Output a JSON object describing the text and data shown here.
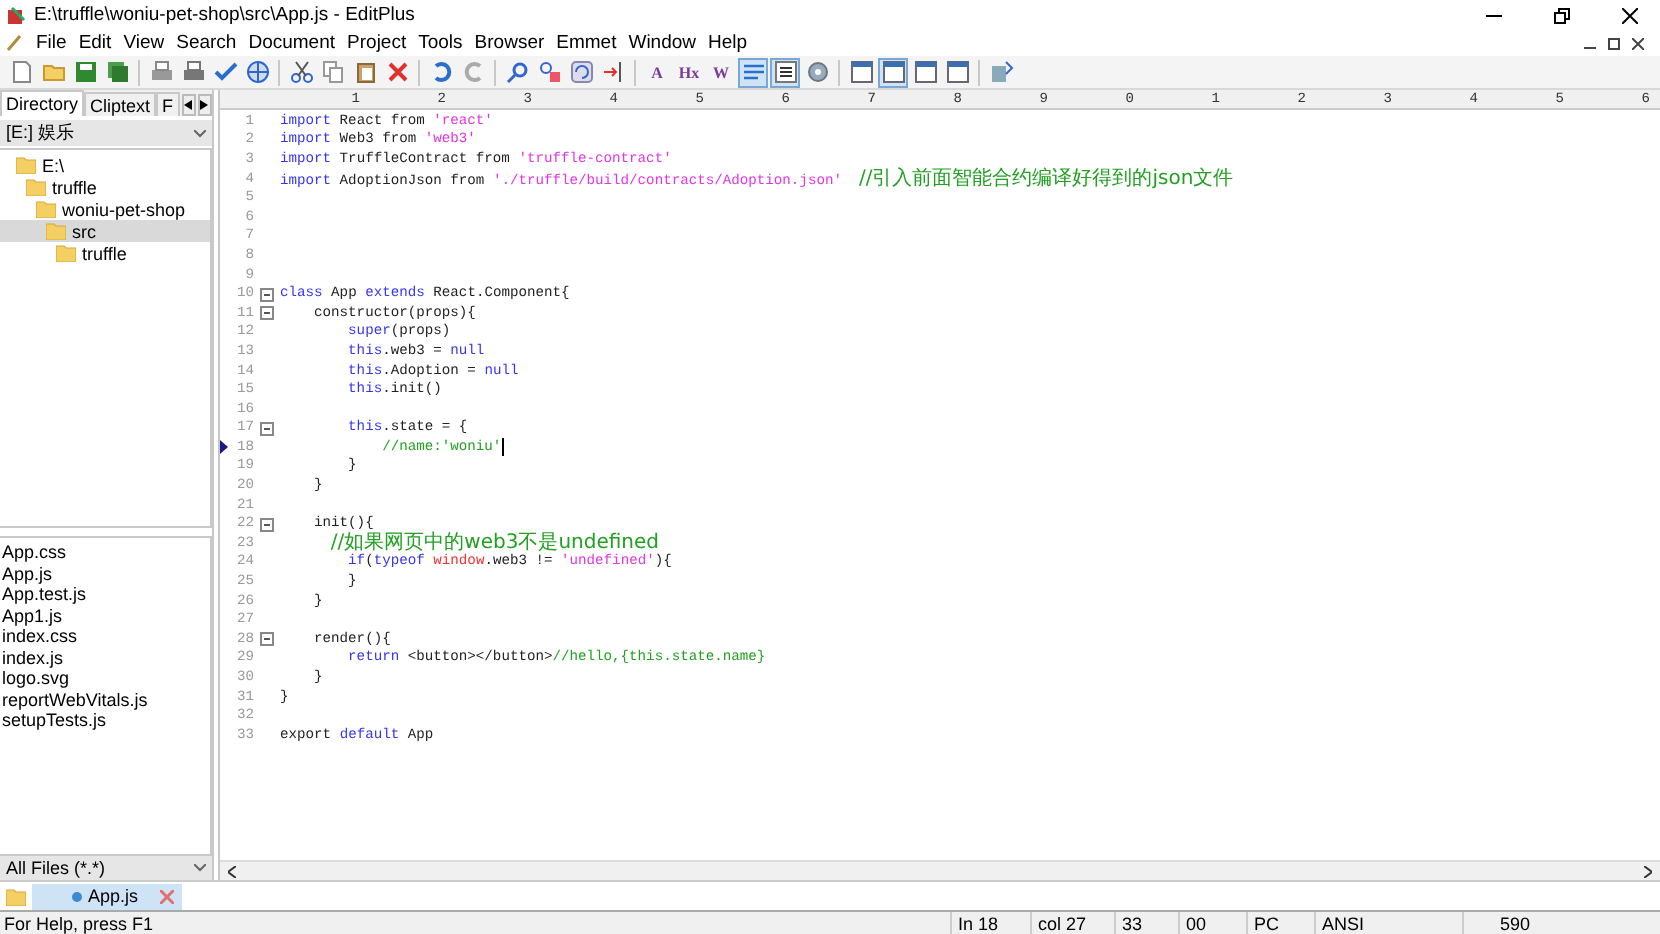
{
  "window": {
    "title": "E:\\truffle\\woniu-pet-shop\\src\\App.js - EditPlus"
  },
  "menu": [
    "File",
    "Edit",
    "View",
    "Search",
    "Document",
    "Project",
    "Tools",
    "Browser",
    "Emmet",
    "Window",
    "Help"
  ],
  "toolbar": [
    {
      "kind": "new",
      "pressed": false
    },
    {
      "kind": "open",
      "pressed": false
    },
    {
      "kind": "save",
      "pressed": false
    },
    {
      "kind": "saveall",
      "pressed": false
    },
    {
      "kind": "sep"
    },
    {
      "kind": "preview",
      "pressed": false
    },
    {
      "kind": "print",
      "pressed": false
    },
    {
      "kind": "spell",
      "pressed": false
    },
    {
      "kind": "browser",
      "pressed": false
    },
    {
      "kind": "sep"
    },
    {
      "kind": "cut",
      "pressed": false
    },
    {
      "kind": "copy",
      "pressed": false
    },
    {
      "kind": "paste",
      "pressed": false
    },
    {
      "kind": "delete",
      "pressed": false
    },
    {
      "kind": "sep"
    },
    {
      "kind": "undo",
      "pressed": false
    },
    {
      "kind": "redo",
      "pressed": false
    },
    {
      "kind": "sep"
    },
    {
      "kind": "find",
      "pressed": false
    },
    {
      "kind": "replace",
      "pressed": false
    },
    {
      "kind": "refresh",
      "pressed": false
    },
    {
      "kind": "goto",
      "pressed": false
    },
    {
      "kind": "sep"
    },
    {
      "kind": "glyph",
      "label": "A",
      "pressed": false
    },
    {
      "kind": "glyph",
      "label": "Hx",
      "pressed": false
    },
    {
      "kind": "glyph",
      "label": "W",
      "pressed": false
    },
    {
      "kind": "wrap",
      "pressed": true
    },
    {
      "kind": "linenum",
      "pressed": true
    },
    {
      "kind": "gear",
      "pressed": false
    },
    {
      "kind": "sep"
    },
    {
      "kind": "window",
      "pressed": false
    },
    {
      "kind": "window",
      "pressed": true
    },
    {
      "kind": "window",
      "pressed": false
    },
    {
      "kind": "window",
      "pressed": false
    },
    {
      "kind": "sep"
    },
    {
      "kind": "help",
      "pressed": false
    }
  ],
  "sidebar": {
    "tabs": [
      {
        "label": "Directory",
        "selected": true
      },
      {
        "label": "Cliptext",
        "selected": false
      },
      {
        "label": "F",
        "selected": false
      }
    ],
    "drive": "[E:] 娱乐",
    "tree": [
      {
        "label": "E:\\",
        "selected": false,
        "children": [
          {
            "label": "truffle",
            "selected": false,
            "children": [
              {
                "label": "woniu-pet-shop",
                "selected": false,
                "children": [
                  {
                    "label": "src",
                    "selected": true,
                    "children": [
                      {
                        "label": "truffle",
                        "selected": false
                      }
                    ]
                  }
                ]
              }
            ]
          }
        ]
      }
    ],
    "files": [
      "App.css",
      "App.js",
      "App.test.js",
      "App1.js",
      "index.css",
      "index.js",
      "logo.svg",
      "reportWebVitals.js",
      "setupTests.js"
    ],
    "filter": "All Files (*.*)"
  },
  "ruler": [
    "1",
    "2",
    "3",
    "4",
    "5",
    "6",
    "7",
    "8",
    "9",
    "0",
    "1",
    "2",
    "3",
    "4",
    "5",
    "6"
  ],
  "code": [
    {
      "number": "1",
      "fold": false,
      "current": false,
      "tokens": [
        {
          "kind": "kw",
          "text": "import"
        },
        {
          "kind": "plain",
          "text": " React from "
        },
        {
          "kind": "str",
          "text": "'react'"
        }
      ]
    },
    {
      "number": "2",
      "fold": false,
      "current": false,
      "tokens": [
        {
          "kind": "kw",
          "text": "import"
        },
        {
          "kind": "plain",
          "text": " Web3 from "
        },
        {
          "kind": "str",
          "text": "'web3'"
        }
      ]
    },
    {
      "number": "3",
      "fold": false,
      "current": false,
      "tokens": [
        {
          "kind": "kw",
          "text": "import"
        },
        {
          "kind": "plain",
          "text": " TruffleContract from "
        },
        {
          "kind": "str",
          "text": "'truffle-contract'"
        }
      ]
    },
    {
      "number": "4",
      "fold": false,
      "current": false,
      "tokens": [
        {
          "kind": "kw",
          "text": "import"
        },
        {
          "kind": "plain",
          "text": " AdoptionJson from "
        },
        {
          "kind": "str",
          "text": "'./truffle/build/contracts/Adoption.json'  "
        },
        {
          "kind": "cjk",
          "text": "//引入前面智能合约编译好得到的json文件"
        }
      ]
    },
    {
      "number": "5",
      "fold": false,
      "current": false
    },
    {
      "number": "6",
      "fold": false,
      "current": false
    },
    {
      "number": "7",
      "fold": false,
      "current": false
    },
    {
      "number": "8",
      "fold": false,
      "current": false
    },
    {
      "number": "9",
      "fold": false,
      "current": false
    },
    {
      "number": "10",
      "fold": true,
      "current": false,
      "tokens": [
        {
          "kind": "kw",
          "text": "class"
        },
        {
          "kind": "plain",
          "text": " App "
        },
        {
          "kind": "kw",
          "text": "extends"
        },
        {
          "kind": "plain",
          "text": " React.Component{"
        }
      ]
    },
    {
      "number": "11",
      "fold": true,
      "current": false,
      "tokens": [
        {
          "kind": "plain",
          "text": "    constructor(props){"
        }
      ]
    },
    {
      "number": "12",
      "fold": false,
      "current": false,
      "tokens": [
        {
          "kind": "kw",
          "text": "        super"
        },
        {
          "kind": "plain",
          "text": "(props)"
        }
      ]
    },
    {
      "number": "13",
      "fold": false,
      "current": false,
      "tokens": [
        {
          "kind": "kw",
          "text": "        this"
        },
        {
          "kind": "plain",
          "text": ".web3 = "
        },
        {
          "kind": "kw",
          "text": "null"
        }
      ]
    },
    {
      "number": "14",
      "fold": false,
      "current": false,
      "tokens": [
        {
          "kind": "kw",
          "text": "        this"
        },
        {
          "kind": "plain",
          "text": ".Adoption = "
        },
        {
          "kind": "kw",
          "text": "null"
        }
      ]
    },
    {
      "number": "15",
      "fold": false,
      "current": false,
      "tokens": [
        {
          "kind": "kw",
          "text": "        this"
        },
        {
          "kind": "plain",
          "text": ".init()"
        }
      ]
    },
    {
      "number": "16",
      "fold": false,
      "current": false
    },
    {
      "number": "17",
      "fold": true,
      "current": false,
      "tokens": [
        {
          "kind": "kw",
          "text": "        this"
        },
        {
          "kind": "plain",
          "text": ".state = {"
        }
      ]
    },
    {
      "number": "18",
      "fold": false,
      "current": true,
      "tokens": [
        {
          "kind": "com",
          "text": "            //name:'woniu'"
        }
      ]
    },
    {
      "number": "19",
      "fold": false,
      "current": false,
      "tokens": [
        {
          "kind": "plain",
          "text": "        }"
        }
      ]
    },
    {
      "number": "20",
      "fold": false,
      "current": false,
      "tokens": [
        {
          "kind": "plain",
          "text": "    }"
        }
      ]
    },
    {
      "number": "21",
      "fold": false,
      "current": false
    },
    {
      "number": "22",
      "fold": true,
      "current": false,
      "tokens": [
        {
          "kind": "plain",
          "text": "    init(){"
        }
      ]
    },
    {
      "number": "23",
      "fold": false,
      "current": false,
      "tokens": [
        {
          "kind": "cjk",
          "text": "        //如果网页中的web3不是undefined"
        }
      ]
    },
    {
      "number": "24",
      "fold": false,
      "current": false,
      "tokens": [
        {
          "kind": "kw",
          "text": "        if"
        },
        {
          "kind": "plain",
          "text": "("
        },
        {
          "kind": "kw",
          "text": "typeof "
        },
        {
          "kind": "builtin",
          "text": "window"
        },
        {
          "kind": "plain",
          "text": ".web3 != "
        },
        {
          "kind": "str",
          "text": "'undefined'"
        },
        {
          "kind": "plain",
          "text": "){"
        }
      ]
    },
    {
      "number": "25",
      "fold": false,
      "current": false,
      "tokens": [
        {
          "kind": "plain",
          "text": "        }"
        }
      ]
    },
    {
      "number": "26",
      "fold": false,
      "current": false,
      "tokens": [
        {
          "kind": "plain",
          "text": "    }"
        }
      ]
    },
    {
      "number": "27",
      "fold": false,
      "current": false
    },
    {
      "number": "28",
      "fold": true,
      "current": false,
      "tokens": [
        {
          "kind": "plain",
          "text": "    render(){"
        }
      ]
    },
    {
      "number": "29",
      "fold": false,
      "current": false,
      "tokens": [
        {
          "kind": "kw",
          "text": "        return"
        },
        {
          "kind": "plain",
          "text": " <button></button>"
        },
        {
          "kind": "com",
          "text": "//hello,{this.state.name}"
        }
      ]
    },
    {
      "number": "30",
      "fold": false,
      "current": false,
      "tokens": [
        {
          "kind": "plain",
          "text": "    }"
        }
      ]
    },
    {
      "number": "31",
      "fold": false,
      "current": false,
      "tokens": [
        {
          "kind": "plain",
          "text": "}"
        }
      ]
    },
    {
      "number": "32",
      "fold": false,
      "current": false
    },
    {
      "number": "33",
      "fold": false,
      "current": false,
      "tokens": [
        {
          "kind": "plain",
          "text": "export "
        },
        {
          "kind": "kw",
          "text": "default"
        },
        {
          "kind": "plain",
          "text": " App"
        }
      ]
    }
  ],
  "doc_tabs": [
    {
      "label": "App.js",
      "selected": true
    }
  ],
  "status_bar": {
    "help": "For Help, press F1",
    "fields": [
      "In 18",
      "col 27",
      "33",
      "00",
      "PC",
      "ANSI",
      "590"
    ]
  }
}
